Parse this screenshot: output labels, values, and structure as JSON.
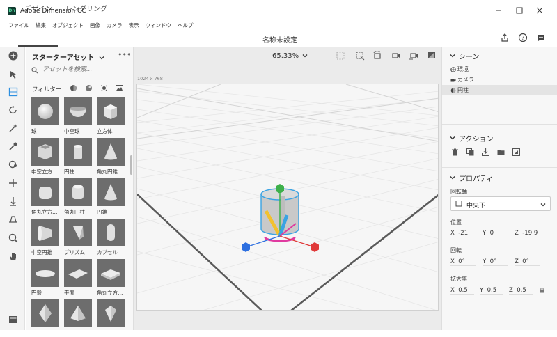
{
  "window": {
    "title": "Adobe Dimension CC",
    "icon_text": "Dn"
  },
  "menu": [
    "ファイル",
    "編集",
    "オブジェクト",
    "画像",
    "カメラ",
    "表示",
    "ウィンドウ",
    "ヘルプ"
  ],
  "tabs": {
    "design": "デザイン",
    "render": "レンダリング"
  },
  "document_title": "名称未設定",
  "assets": {
    "title": "スターターアセット",
    "search_placeholder": "アセットを検索...",
    "filter_label": "フィルター",
    "items": [
      {
        "label": "球",
        "shape": "sphere"
      },
      {
        "label": "中空球",
        "shape": "bowl"
      },
      {
        "label": "立方体",
        "shape": "cube"
      },
      {
        "label": "中空立方…",
        "shape": "hollowcube"
      },
      {
        "label": "円柱",
        "shape": "cylinder"
      },
      {
        "label": "角丸円錐",
        "shape": "cone"
      },
      {
        "label": "角丸立方…",
        "shape": "roundcube"
      },
      {
        "label": "角丸円柱",
        "shape": "roundcyl"
      },
      {
        "label": "円錐",
        "shape": "cone"
      },
      {
        "label": "中空円錐",
        "shape": "hollowcone"
      },
      {
        "label": "プリズム",
        "shape": "prism"
      },
      {
        "label": "カプセル",
        "shape": "capsule"
      },
      {
        "label": "円盤",
        "shape": "disc"
      },
      {
        "label": "平面",
        "shape": "plane"
      },
      {
        "label": "角丸立方…",
        "shape": "roundbox"
      },
      {
        "label": "",
        "shape": "octa"
      },
      {
        "label": "",
        "shape": "pyramid"
      },
      {
        "label": "",
        "shape": "gem"
      }
    ]
  },
  "viewport": {
    "zoom": "65.33%",
    "canvas_size": "1024 x 768"
  },
  "scene": {
    "title": "シーン",
    "items": [
      {
        "label": "環境",
        "icon": "environment-icon"
      },
      {
        "label": "カメラ",
        "icon": "camera-icon"
      },
      {
        "label": "円柱",
        "icon": "object-icon",
        "selected": true
      }
    ]
  },
  "actions": {
    "title": "アクション"
  },
  "properties": {
    "title": "プロパティ",
    "anchor_label": "回転軸",
    "anchor_value": "中央下",
    "position_label": "位置",
    "position": {
      "x": "-21",
      "y": "0",
      "z": "-19.9"
    },
    "rotation_label": "回転",
    "rotation": {
      "x": "0°",
      "y": "0°",
      "z": "0°"
    },
    "scale_label": "拡大率",
    "scale": {
      "x": "0.5",
      "y": "0.5",
      "z": "0.5"
    },
    "axis_names": {
      "x": "X",
      "y": "Y",
      "z": "Z"
    }
  },
  "colors": {
    "accent_green": "#3db04a",
    "axis_blue": "#2d6fe0",
    "axis_red": "#e03a3a",
    "selection": "#3aa3e3"
  }
}
